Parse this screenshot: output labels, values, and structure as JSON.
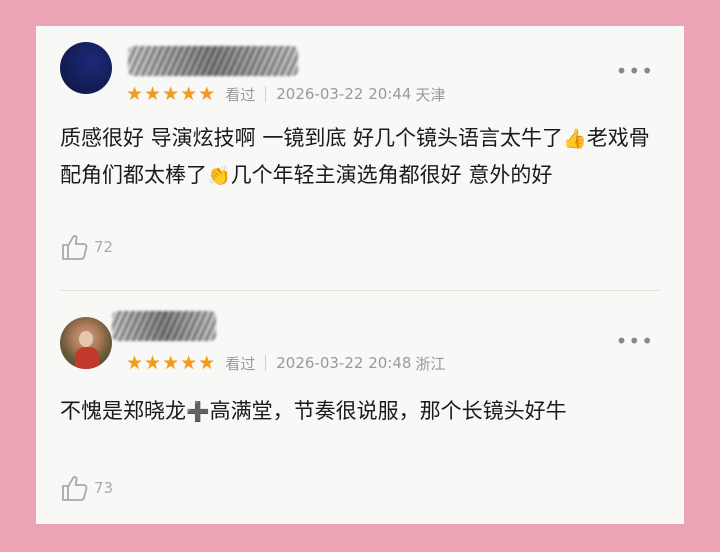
{
  "reviews": [
    {
      "nickname": "",
      "rating_stars": 5,
      "watched_label": "看过",
      "datetime": "2026-03-22 20:44",
      "location": "天津",
      "text_parts": [
        "质感很好 导演炫技啊 一镜到底 好几个镜头语言太牛了",
        "👍",
        "老戏骨配角们都太棒了",
        "👏",
        "几个年轻主演选角都很好 意外的好"
      ],
      "likes": "72"
    },
    {
      "nickname": "",
      "rating_stars": 5,
      "watched_label": "看过",
      "datetime": "2026-03-22 20:48",
      "location": "浙江",
      "text_parts": [
        "不愧是郑晓龙",
        "➕",
        "高满堂，节奏很说服，那个长镜头好牛"
      ],
      "likes": "73"
    }
  ],
  "icons": {
    "star": "star-icon",
    "more": "more-icon",
    "like": "thumbs-up-icon"
  },
  "colors": {
    "background": "#eba4b3",
    "card": "#f8f8f6",
    "star": "#f59a1b",
    "meta_text": "#9a9a9a"
  }
}
